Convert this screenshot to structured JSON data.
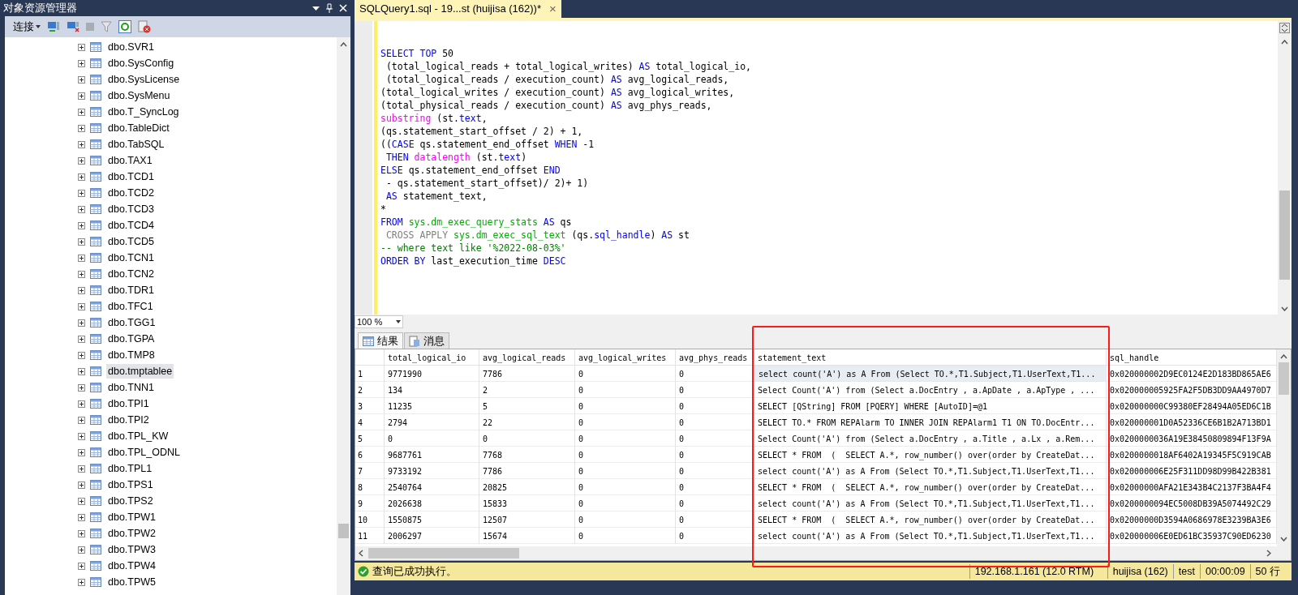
{
  "object_explorer": {
    "title": "对象资源管理器",
    "connect_label": "连接",
    "items": [
      {
        "label": "dbo.SVR1",
        "selected": false
      },
      {
        "label": "dbo.SysConfig",
        "selected": false
      },
      {
        "label": "dbo.SysLicense",
        "selected": false
      },
      {
        "label": "dbo.SysMenu",
        "selected": false
      },
      {
        "label": "dbo.T_SyncLog",
        "selected": false
      },
      {
        "label": "dbo.TableDict",
        "selected": false
      },
      {
        "label": "dbo.TabSQL",
        "selected": false
      },
      {
        "label": "dbo.TAX1",
        "selected": false
      },
      {
        "label": "dbo.TCD1",
        "selected": false
      },
      {
        "label": "dbo.TCD2",
        "selected": false
      },
      {
        "label": "dbo.TCD3",
        "selected": false
      },
      {
        "label": "dbo.TCD4",
        "selected": false
      },
      {
        "label": "dbo.TCD5",
        "selected": false
      },
      {
        "label": "dbo.TCN1",
        "selected": false
      },
      {
        "label": "dbo.TCN2",
        "selected": false
      },
      {
        "label": "dbo.TDR1",
        "selected": false
      },
      {
        "label": "dbo.TFC1",
        "selected": false
      },
      {
        "label": "dbo.TGG1",
        "selected": false
      },
      {
        "label": "dbo.TGPA",
        "selected": false
      },
      {
        "label": "dbo.TMP8",
        "selected": false
      },
      {
        "label": "dbo.tmptablee",
        "selected": true
      },
      {
        "label": "dbo.TNN1",
        "selected": false
      },
      {
        "label": "dbo.TPI1",
        "selected": false
      },
      {
        "label": "dbo.TPI2",
        "selected": false
      },
      {
        "label": "dbo.TPL_KW",
        "selected": false
      },
      {
        "label": "dbo.TPL_ODNL",
        "selected": false
      },
      {
        "label": "dbo.TPL1",
        "selected": false
      },
      {
        "label": "dbo.TPS1",
        "selected": false
      },
      {
        "label": "dbo.TPS2",
        "selected": false
      },
      {
        "label": "dbo.TPW1",
        "selected": false
      },
      {
        "label": "dbo.TPW2",
        "selected": false
      },
      {
        "label": "dbo.TPW3",
        "selected": false
      },
      {
        "label": "dbo.TPW4",
        "selected": false
      },
      {
        "label": "dbo.TPW5",
        "selected": false
      }
    ]
  },
  "editor": {
    "tab": {
      "title": "SQLQuery1.sql - 19...st (huijisa (162))*",
      "close": "×"
    },
    "code": [
      [
        {
          "kind": "kw",
          "text": "SELECT TOP"
        },
        {
          "kind": "plain",
          "text": " 50"
        }
      ],
      [
        {
          "kind": "plain",
          "text": " (total_logical_reads + total_logical_writes) "
        },
        {
          "kind": "kw",
          "text": "AS"
        },
        {
          "kind": "plain",
          "text": " total_logical_io,"
        }
      ],
      [
        {
          "kind": "plain",
          "text": " (total_logical_reads / execution_count) "
        },
        {
          "kind": "kw",
          "text": "AS"
        },
        {
          "kind": "plain",
          "text": " avg_logical_reads,"
        }
      ],
      [
        {
          "kind": "plain",
          "text": "(total_logical_writes / execution_count) "
        },
        {
          "kind": "kw",
          "text": "AS"
        },
        {
          "kind": "plain",
          "text": " avg_logical_writes,"
        }
      ],
      [
        {
          "kind": "plain",
          "text": "(total_physical_reads / execution_count) "
        },
        {
          "kind": "kw",
          "text": "AS"
        },
        {
          "kind": "plain",
          "text": " avg_phys_reads,"
        }
      ],
      [
        {
          "kind": "fn",
          "text": "substring"
        },
        {
          "kind": "plain",
          "text": " (st."
        },
        {
          "kind": "kw",
          "text": "text"
        },
        {
          "kind": "plain",
          "text": ","
        }
      ],
      [
        {
          "kind": "plain",
          "text": "(qs.statement_start_offset / 2) + 1,"
        }
      ],
      [
        {
          "kind": "plain",
          "text": "(("
        },
        {
          "kind": "kw",
          "text": "CASE"
        },
        {
          "kind": "plain",
          "text": " qs.statement_end_offset "
        },
        {
          "kind": "kw",
          "text": "WHEN"
        },
        {
          "kind": "plain",
          "text": " -1"
        }
      ],
      [
        {
          "kind": "kw",
          "text": " THEN"
        },
        {
          "kind": "fn",
          "text": " datalength"
        },
        {
          "kind": "plain",
          "text": " (st."
        },
        {
          "kind": "kw",
          "text": "text"
        },
        {
          "kind": "plain",
          "text": ")"
        }
      ],
      [
        {
          "kind": "kw",
          "text": "ELSE"
        },
        {
          "kind": "plain",
          "text": " qs.statement_end_offset "
        },
        {
          "kind": "kw",
          "text": "END"
        }
      ],
      [
        {
          "kind": "plain",
          "text": " - qs.statement_start_offset)/ 2)+ 1)"
        }
      ],
      [
        {
          "kind": "kw",
          "text": " AS"
        },
        {
          "kind": "plain",
          "text": " statement_text,"
        }
      ],
      [
        {
          "kind": "plain",
          "text": "*"
        }
      ],
      [
        {
          "kind": "kw",
          "text": "FROM"
        },
        {
          "kind": "sys",
          "text": " sys.dm_exec_query_stats"
        },
        {
          "kind": "kw",
          "text": " AS"
        },
        {
          "kind": "plain",
          "text": " qs"
        }
      ],
      [
        {
          "kind": "gray",
          "text": " CROSS APPLY"
        },
        {
          "kind": "sys",
          "text": " sys.dm_exec_sql_text"
        },
        {
          "kind": "plain",
          "text": " (qs."
        },
        {
          "kind": "kw",
          "text": "sql_handle"
        },
        {
          "kind": "plain",
          "text": ") "
        },
        {
          "kind": "kw",
          "text": "AS"
        },
        {
          "kind": "plain",
          "text": " st"
        }
      ],
      [
        {
          "kind": "comment",
          "text": "-- where text like '%2022-08-03%'"
        }
      ],
      [
        {
          "kind": "kw",
          "text": "ORDER BY"
        },
        {
          "kind": "plain",
          "text": " last_execution_time "
        },
        {
          "kind": "kw",
          "text": "DESC"
        }
      ]
    ],
    "zoom": "100 %"
  },
  "results_tabs": [
    {
      "label": "结果",
      "selected": true
    },
    {
      "label": "消息",
      "selected": false
    }
  ],
  "table": {
    "columns": [
      "total_logical_io",
      "avg_logical_reads",
      "avg_logical_writes",
      "avg_phys_reads",
      "statement_text",
      "sql_handle"
    ],
    "rows": [
      {
        "num": "1",
        "cells": [
          "9771990",
          "7786",
          "0",
          "0",
          "select count('A') as A From (Select TO.*,T1.Subject,T1.UserText,T1...",
          "0x020000002D9EC0124E2D183BD865AE6"
        ],
        "focused": true
      },
      {
        "num": "2",
        "cells": [
          "134",
          "2",
          "0",
          "0",
          "Select Count('A') from (Select a.DocEntry , a.ApDate , a.ApType , ...",
          "0x020000005925FA2F5DB3DD9AA4970D7"
        ],
        "focused": false
      },
      {
        "num": "3",
        "cells": [
          "11235",
          "5",
          "0",
          "0",
          "SELECT [QString] FROM [PQERY] WHERE [AutoID]=@1",
          "0x020000000C99380EF28494A05ED6C1B"
        ],
        "focused": false
      },
      {
        "num": "4",
        "cells": [
          "2794",
          "22",
          "0",
          "0",
          "SELECT TO.* FROM REPAlarm TO INNER JOIN REPAlarm1 T1 ON TO.DocEntr...",
          "0x020000001D0A52336CE6B1B2A713BD1"
        ],
        "focused": false
      },
      {
        "num": "5",
        "cells": [
          "0",
          "0",
          "0",
          "0",
          "Select Count('A') from (Select a.DocEntry , a.Title , a.Lx , a.Rem...",
          "0x0200000036A19E38450809894F13F9A"
        ],
        "focused": false
      },
      {
        "num": "6",
        "cells": [
          "9687761",
          "7768",
          "0",
          "0",
          "SELECT * FROM  (  SELECT A.*, row_number() over(order by CreateDat...",
          "0x0200000018AF6402A19345F5C919CAB"
        ],
        "focused": false
      },
      {
        "num": "7",
        "cells": [
          "9733192",
          "7786",
          "0",
          "0",
          "select count('A') as A From (Select TO.*,T1.Subject,T1.UserText,T1...",
          "0x020000006E25F311DD98D99B422B381"
        ],
        "focused": false
      },
      {
        "num": "8",
        "cells": [
          "2540764",
          "20825",
          "0",
          "0",
          "SELECT * FROM  (  SELECT A.*, row_number() over(order by CreateDat...",
          "0x02000000AFA21E343B4C2137F3BA4F4"
        ],
        "focused": false
      },
      {
        "num": "9",
        "cells": [
          "2026638",
          "15833",
          "0",
          "0",
          "select count('A') as A From (Select TO.*,T1.Subject,T1.UserText,T1...",
          "0x0200000094EC5008DB39A5074492C29"
        ],
        "focused": false
      },
      {
        "num": "10",
        "cells": [
          "1550875",
          "12507",
          "0",
          "0",
          "SELECT * FROM  (  SELECT A.*, row_number() over(order by CreateDat...",
          "0x02000000D3594A0686978E3239BA3E6"
        ],
        "focused": false
      },
      {
        "num": "11",
        "cells": [
          "2006297",
          "15674",
          "0",
          "0",
          "select count('A') as A From (Select TO.*,T1.Subject,T1.UserText,T1...",
          "0x020000006E0ED61BC35937C90ED6230"
        ],
        "focused": false
      }
    ]
  },
  "status_bar": {
    "message": "查询已成功执行。",
    "server": "192.168.1.161 (12.0 RTM)",
    "user": "huijisa (162)",
    "database": "test",
    "elapsed": "00:00:09",
    "rows": "50 行"
  }
}
